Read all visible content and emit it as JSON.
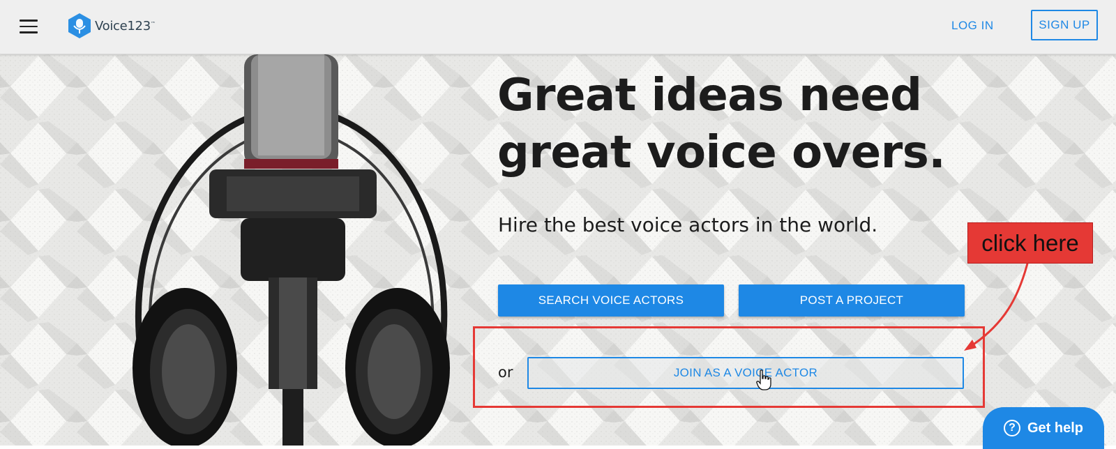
{
  "header": {
    "brand": "Voice123",
    "brand_tm": "™",
    "login_label": "LOG IN",
    "signup_label": "SIGN UP"
  },
  "hero": {
    "headline_line1": "Great ideas need",
    "headline_line2": "great voice overs.",
    "subheadline": "Hire the best voice actors in the world.",
    "search_button_label": "SEARCH VOICE ACTORS",
    "post_button_label": "POST A PROJECT",
    "or_text": "or",
    "join_button_label": "JOIN AS A VOICE ACTOR"
  },
  "annotation": {
    "callout_text": "click here"
  },
  "help_widget": {
    "icon": "?",
    "label": "Get help"
  },
  "colors": {
    "accent": "#1e88e5",
    "annotation_red": "#e53935",
    "header_bg": "#efefef",
    "text_dark": "#1c1c1c"
  },
  "icons": [
    "menu-icon",
    "voice123-logo-icon",
    "pointer-hand-cursor-icon",
    "question-circle-icon"
  ]
}
